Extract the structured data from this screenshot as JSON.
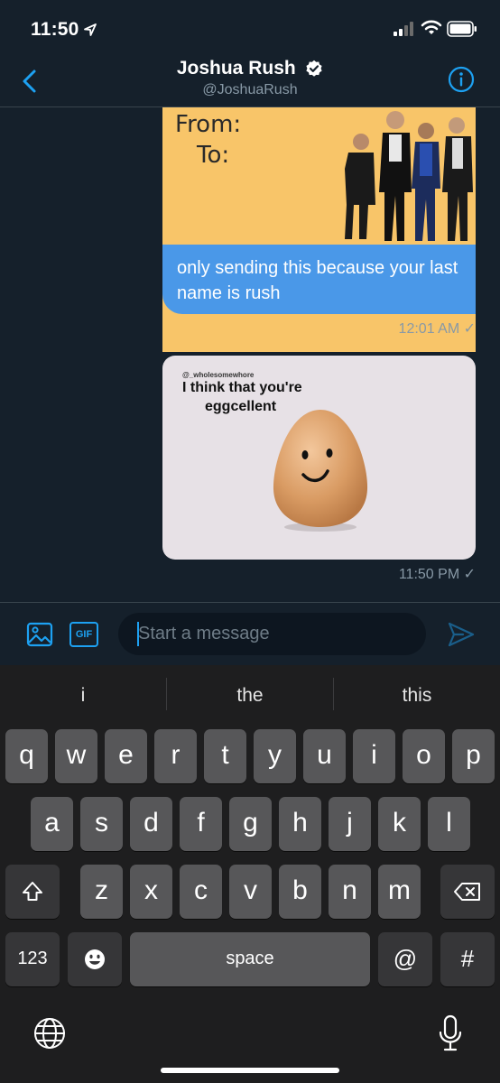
{
  "status_bar": {
    "time": "11:50",
    "icons": [
      "location-arrow-icon",
      "cellular-signal-icon",
      "wifi-icon",
      "battery-icon"
    ]
  },
  "header": {
    "name": "Joshua Rush",
    "handle": "@JoshuaRush",
    "icons": [
      "back-chevron-icon",
      "verified-badge-icon",
      "info-icon"
    ]
  },
  "messages": [
    {
      "image_text": {
        "from": "From:",
        "to": "To:"
      },
      "text": "only sending this because your last name is rush",
      "timestamp": "12:01 AM ✓"
    },
    {
      "image_text": {
        "handle": "@_wholesomewhore",
        "line1": "I think that you're",
        "line2": "eggcellent"
      },
      "timestamp": "11:50 PM ✓"
    }
  ],
  "composer": {
    "gif_label": "GIF",
    "placeholder": "Start a message",
    "value": "",
    "icons": [
      "image-icon",
      "send-icon"
    ]
  },
  "keyboard": {
    "suggestions": [
      "i",
      "the",
      "this"
    ],
    "row1": [
      "q",
      "w",
      "e",
      "r",
      "t",
      "y",
      "u",
      "i",
      "o",
      "p"
    ],
    "row2": [
      "a",
      "s",
      "d",
      "f",
      "g",
      "h",
      "j",
      "k",
      "l"
    ],
    "row3": [
      "z",
      "x",
      "c",
      "v",
      "b",
      "n",
      "m"
    ],
    "numbers_label": "123",
    "space_label": "space",
    "at_label": "@",
    "hash_label": "#",
    "icons": [
      "shift-icon",
      "backspace-icon",
      "emoji-icon",
      "globe-icon",
      "microphone-icon"
    ]
  },
  "colors": {
    "background": "#15202b",
    "accent": "#1da1f2",
    "bubble": "#4a98e8",
    "keyboard": "#1e1e1f",
    "key": "#575759"
  }
}
